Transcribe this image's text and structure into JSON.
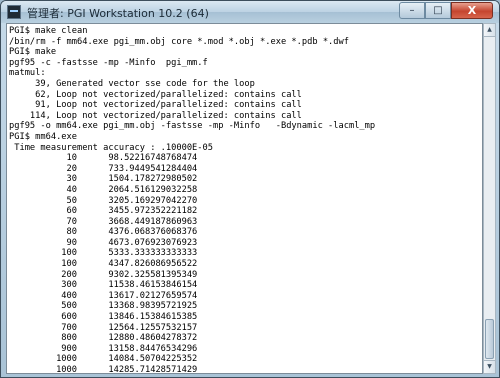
{
  "window": {
    "title": "管理者:  PGI Workstation 10.2 (64)",
    "minimize_label": "–",
    "maximize_label": "□",
    "close_label": "X"
  },
  "console": {
    "lines": [
      "PGI$ make clean",
      "/bin/rm -f mm64.exe pgi_mm.obj core *.mod *.obj *.exe *.pdb *.dwf",
      "PGI$ make",
      "pgf95 -c -fastsse -mp -Minfo  pgi_mm.f",
      "matmul:",
      "     39, Generated vector sse code for the loop",
      "     62, Loop not vectorized/parallelized: contains call",
      "     91, Loop not vectorized/parallelized: contains call",
      "    114, Loop not vectorized/parallelized: contains call",
      "pgf95 -o mm64.exe pgi_mm.obj -fastsse -mp -Minfo   -Bdynamic -lacml_mp",
      "PGI$ mm64.exe",
      " Time measurement accuracy : .10000E-05",
      "           10      98.52216748768474",
      "           20      733.9449541284404",
      "           30      1504.178272980502",
      "           40      2064.516129032258",
      "           50      3205.169297042270",
      "           60      3455.972352221182",
      "           70      3668.449187860963",
      "           80      4376.068376068376",
      "           90      4673.076923076923",
      "          100      5333.333333333333",
      "          100      4347.826086956522",
      "          200      9302.325581395349",
      "          300      11538.46153846154",
      "          400      13617.02127659574",
      "          500      13368.98395721925",
      "          600      13846.15384615385",
      "          700      12564.12557532157",
      "          800      12880.48604278372",
      "          900      13158.84476534296",
      "         1000      14084.50704225352",
      "         1000      14285.71428571429"
    ]
  }
}
